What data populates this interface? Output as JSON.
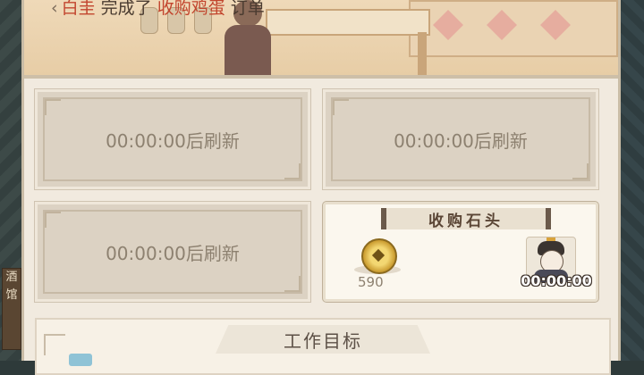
{
  "notice": {
    "back_glyph": "‹",
    "player": "白圭",
    "action": "完成了",
    "order_name": "收购鸡蛋",
    "suffix": "订单"
  },
  "cards": [
    {
      "refresh_text": "00:00:00后刷新"
    },
    {
      "refresh_text": "00:00:00后刷新"
    },
    {
      "refresh_text": "00:00:00后刷新"
    }
  ],
  "active_order": {
    "title": "收购石头",
    "reward_amount": "590",
    "timer": "00:00:00",
    "reward_icon": "copper-coin-icon",
    "worker_icon": "worker-avatar"
  },
  "work_target": {
    "title": "工作目标"
  },
  "sign_text": [
    "酒",
    "馆"
  ],
  "colors": {
    "highlight": "#c2452e",
    "text": "#4a3b30",
    "muted": "#8d8170"
  }
}
